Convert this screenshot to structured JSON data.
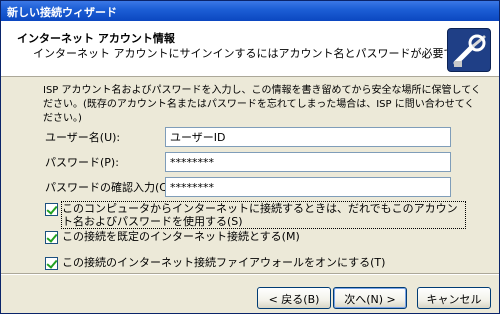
{
  "window": {
    "title": "新しい接続ウィザード"
  },
  "header": {
    "title": "インターネット アカウント情報",
    "subtitle": "インターネット アカウントにサインインするにはアカウント名とパスワードが必要です。",
    "icon": "network-key-icon"
  },
  "body": {
    "description": "ISP アカウント名およびパスワードを入力し、この情報を書き留めてから安全な場所に保管してください。(既存のアカウント名またはパスワードを忘れてしまった場合は、ISP に問い合わせてください。)"
  },
  "form": {
    "username_label": "ユーザー名(U):",
    "username_value": "ユーザーID",
    "password_label": "パスワード(P):",
    "password_value": "********",
    "confirm_label": "パスワードの確認入力(C):",
    "confirm_value": "********"
  },
  "options": {
    "use_for_all_users": "このコンピュータからインターネットに接続するときは、だれでもこのアカウント名およびパスワードを使用する(S)",
    "default_connection": "この接続を既定のインターネット接続とする(M)",
    "firewall_on": "この接続のインターネット接続ファイアウォールをオンにする(T)"
  },
  "buttons": {
    "back": "< 戻る(B)",
    "next": "次へ(N) >",
    "cancel": "キャンセル"
  }
}
